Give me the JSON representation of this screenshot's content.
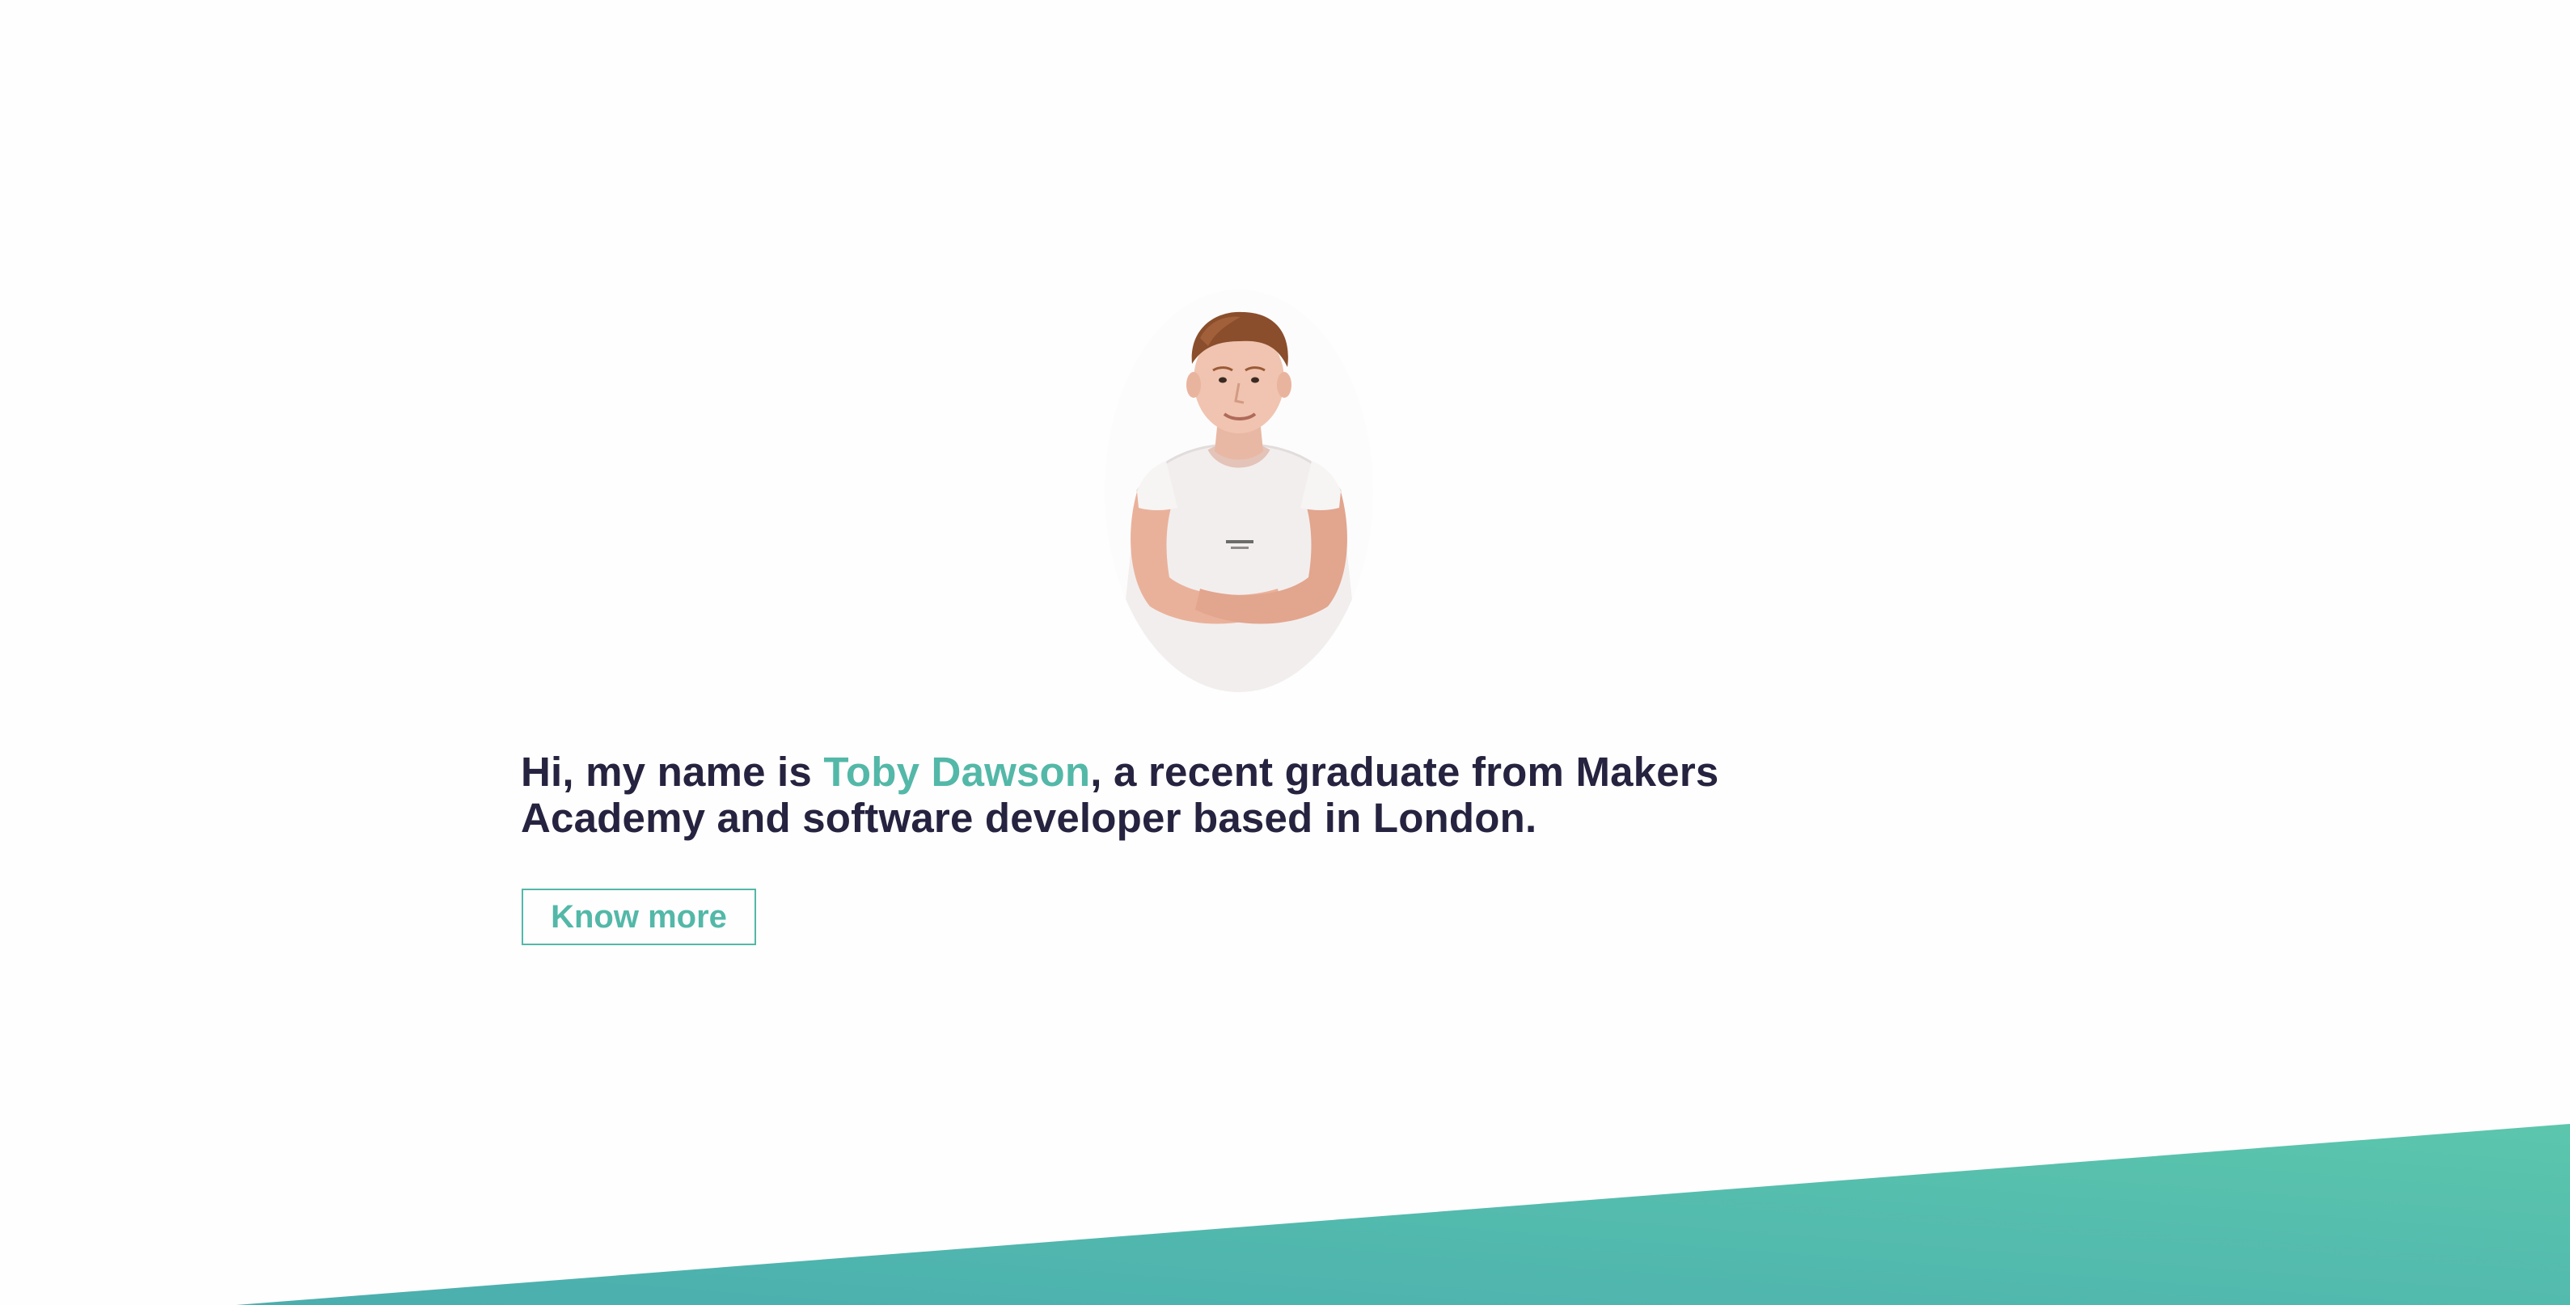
{
  "hero": {
    "intro_prefix": "Hi, my name is ",
    "intro_name": "Toby Dawson",
    "intro_suffix": ", a recent graduate from Makers Academy and software developer based in London.",
    "button_label": "Know more"
  },
  "colors": {
    "accent": "#53b8a8",
    "text": "#25233f",
    "background": "#fefefe",
    "wedge_start": "#4aaeae",
    "wedge_end": "#5cc6ad"
  },
  "icons": {
    "profile_photo": "portrait-photo"
  }
}
